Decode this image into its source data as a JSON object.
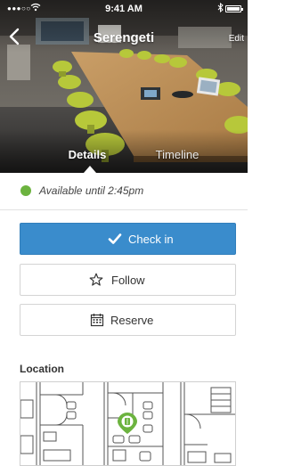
{
  "status_bar": {
    "signal": "●●●○○",
    "time": "9:41 AM",
    "battery_level": 1.0
  },
  "nav": {
    "title": "Serengeti",
    "edit_label": "Edit"
  },
  "tabs": [
    {
      "label": "Details",
      "selected": true
    },
    {
      "label": "Timeline",
      "selected": false
    }
  ],
  "availability": {
    "text": "Available until 2:45pm",
    "status_color": "#6cb33f"
  },
  "actions": {
    "check_in": {
      "label": "Check in",
      "icon": "checkmark-icon",
      "color": "#3a8ccc"
    },
    "follow": {
      "label": "Follow",
      "icon": "star-icon"
    },
    "reserve": {
      "label": "Reserve",
      "icon": "calendar-icon"
    }
  },
  "location": {
    "title": "Location",
    "pin_color": "#6cb33f"
  }
}
